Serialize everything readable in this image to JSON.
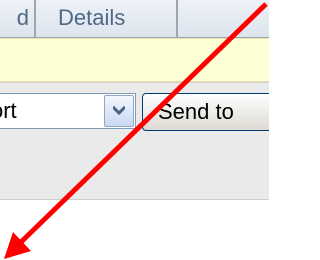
{
  "tabs": {
    "previous_label": "d",
    "details_label": "Details"
  },
  "toolbar": {
    "select_value": "ort",
    "send_button_label": "Send to"
  },
  "annotation": {
    "arrow_color": "#ff0000"
  },
  "colors": {
    "tab_text": "#4e6888",
    "message_band": "#ffffd5",
    "toolbar_background": "#eaeaea"
  }
}
